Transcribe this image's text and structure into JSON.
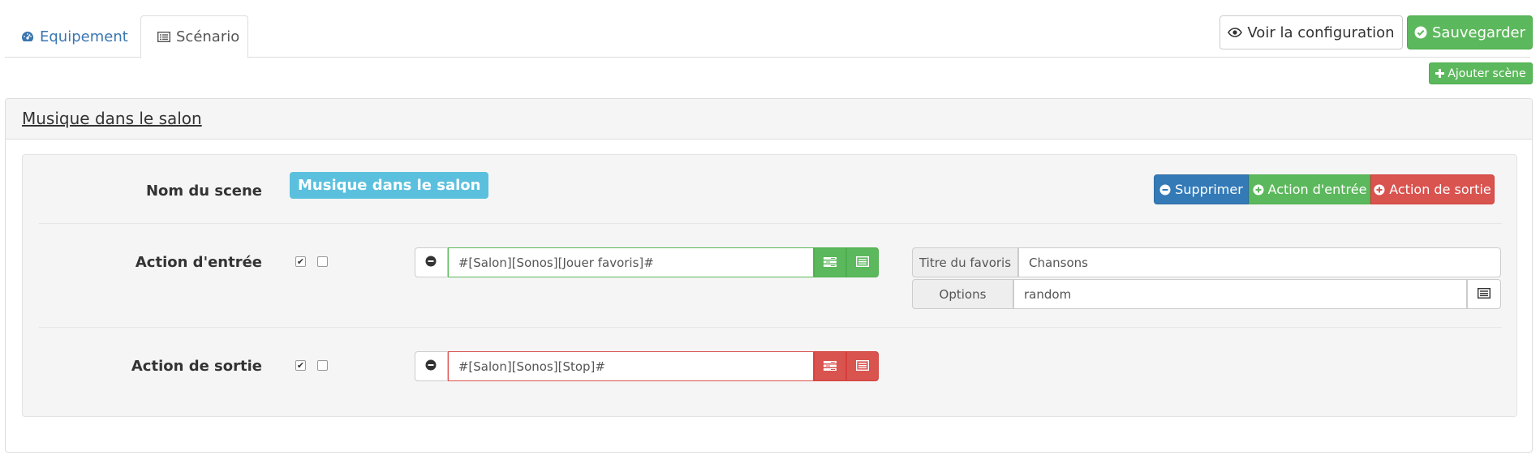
{
  "tabs": [
    {
      "label": "Equipement",
      "icon": "dashboard-icon"
    },
    {
      "label": "Scénario",
      "icon": "list-alt-icon"
    }
  ],
  "toolbar": {
    "view_config_label": "Voir la configuration",
    "save_label": "Sauvegarder",
    "add_scene_label": "Ajouter scène"
  },
  "scene": {
    "title": "Musique dans le salon",
    "name_label": "Nom du scene",
    "name_value": "Musique dans le salon",
    "buttons": {
      "delete": "Supprimer",
      "add_entry": "Action d'entrée",
      "add_exit": "Action de sortie"
    },
    "entry": {
      "label": "Action d'entrée",
      "enabled": true,
      "background": false,
      "command": "#[Salon][Sonos][Jouer favoris]#",
      "options": [
        {
          "label": "Titre du favoris",
          "value": "Chansons"
        },
        {
          "label": "Options",
          "value": "random"
        }
      ]
    },
    "exit": {
      "label": "Action de sortie",
      "enabled": true,
      "background": false,
      "command": "#[Salon][Sonos][Stop]#"
    }
  },
  "colors": {
    "primary": "#337ab7",
    "success": "#5cb85c",
    "danger": "#d9534f",
    "info": "#5bc0de",
    "link": "#3a76b0"
  }
}
